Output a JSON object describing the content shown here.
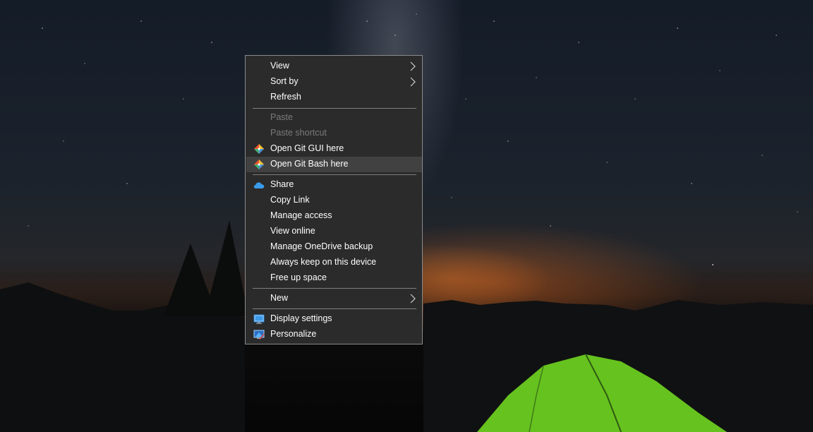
{
  "menu": {
    "view": "View",
    "sort_by": "Sort by",
    "refresh": "Refresh",
    "paste": "Paste",
    "paste_shortcut": "Paste shortcut",
    "open_git_gui": "Open Git GUI here",
    "open_git_bash": "Open Git Bash here",
    "share": "Share",
    "copy_link": "Copy Link",
    "manage_access": "Manage access",
    "view_online": "View online",
    "manage_onedrive_backup": "Manage OneDrive backup",
    "always_keep": "Always keep on this device",
    "free_up_space": "Free up space",
    "new": "New",
    "display_settings": "Display settings",
    "personalize": "Personalize"
  },
  "icons": {
    "git": "git-icon",
    "onedrive": "onedrive-cloud-icon",
    "display": "display-settings-icon",
    "personalize": "personalize-icon",
    "submenu": "chevron-right-icon"
  },
  "colors": {
    "menu_background": "#2b2b2b",
    "menu_border": "#8a8a8a",
    "hover_background": "#414141",
    "disabled_text": "#7a7a7a",
    "text": "#ffffff"
  }
}
